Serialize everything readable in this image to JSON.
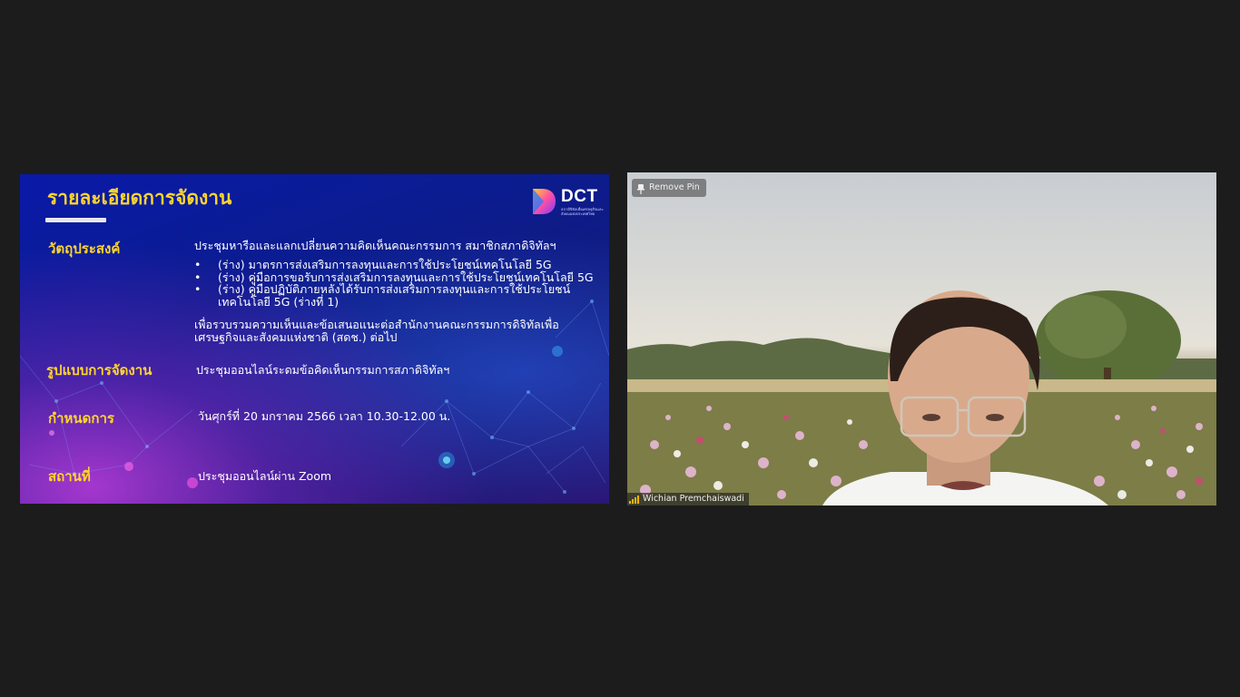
{
  "slide": {
    "title": "รายละเอียดการจัดงาน",
    "logo_text": "DCT",
    "logo_subtitle": "สภาดิจิทัลเพื่อเศรษฐกิจและสังคมแห่งประเทศไทย",
    "sections": {
      "objective": {
        "label": "วัตถุประสงค์",
        "intro": "ประชุมหารือและแลกเปลี่ยนความคิดเห็นคณะกรรมการ สมาชิกสภาดิจิทัลฯ",
        "bullets": [
          {
            "line1": "(ร่าง) มาตรการส่งเสริมการลงทุนและการใช้ประโยชน์เทคโนโลยี 5G",
            "line2": ""
          },
          {
            "line1": "(ร่าง) คู่มือการขอรับการส่งเสริมการลงทุนและการใช้ประโยชน์เทคโนโลยี 5G",
            "line2": ""
          },
          {
            "line1": "(ร่าง) คู่มือปฏิบัติภายหลังได้รับการส่งเสริมการลงทุนและการใช้ประโยชน์",
            "line2": "เทคโนโลยี 5G (ร่างที่ 1)"
          }
        ],
        "closing_line1": "เพื่อรวบรวมความเห็นและข้อเสนอแนะต่อสำนักงานคณะกรรมการดิจิทัลเพื่อ",
        "closing_line2": "เศรษฐกิจและสังคมแห่งชาติ (สดช.) ต่อไป"
      },
      "format": {
        "label": "รูปแบบการจัดงาน",
        "value": "ประชุมออนไลน์ระดมข้อคิดเห็นกรรมการสภาดิจิทัลฯ"
      },
      "schedule": {
        "label": "กำหนดการ",
        "value": "วันศุกร์ที่ 20 มกราคม 2566  เวลา 10.30-12.00 น."
      },
      "venue": {
        "label": "สถานที่",
        "value": "ประชุมออนไลน์ผ่าน Zoom"
      }
    }
  },
  "video": {
    "remove_pin_label": "Remove Pin",
    "participant_name": "Wichian Premchaiswadi",
    "pin_icon": "pin-icon",
    "signal_icon": "signal-bars-icon"
  },
  "colors": {
    "background": "#1c1c1c",
    "slide_label": "#ffd52b",
    "slide_text": "#ffffff",
    "signal": "#f5b400"
  }
}
